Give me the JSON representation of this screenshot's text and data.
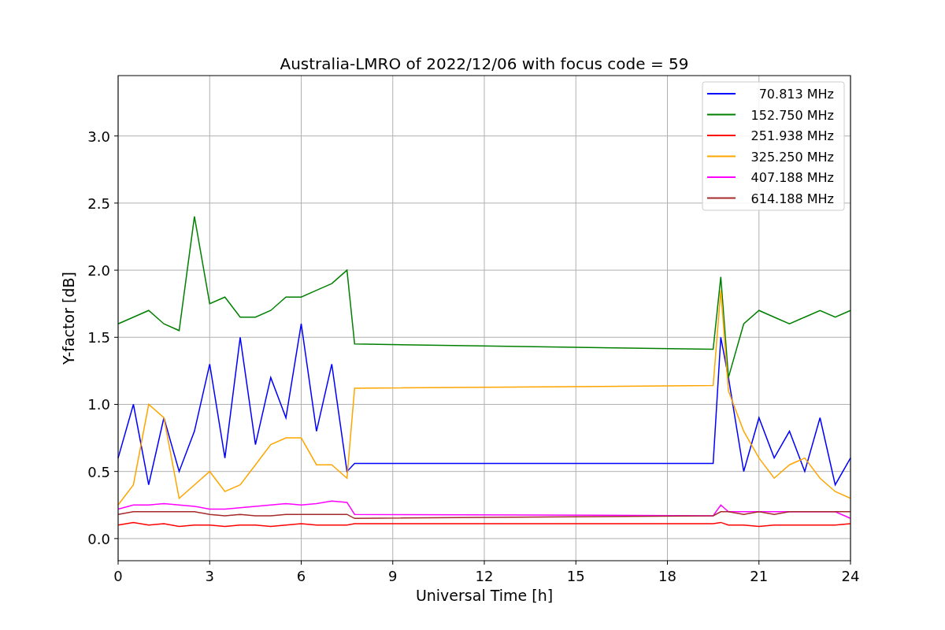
{
  "chart_data": {
    "type": "line",
    "title": "Australia-LMRO of 2022/12/06 with focus code = 59",
    "xlabel": "Universal Time [h]",
    "ylabel": "Y-factor [dB]",
    "x": [
      0,
      0.5,
      1,
      1.5,
      2,
      2.5,
      3,
      3.5,
      4,
      4.5,
      5,
      5.5,
      6,
      6.5,
      7,
      7.5,
      7.75,
      19.5,
      19.75,
      20,
      20.5,
      21,
      21.5,
      22,
      22.5,
      23,
      23.5,
      24
    ],
    "series": [
      {
        "name": "70.813 MHz",
        "color": "#0000ff",
        "values": [
          0.6,
          1.0,
          0.4,
          0.9,
          0.5,
          0.8,
          1.3,
          0.6,
          1.5,
          0.7,
          1.2,
          0.9,
          1.6,
          0.8,
          1.3,
          0.5,
          0.56,
          0.56,
          1.5,
          1.2,
          0.5,
          0.9,
          0.6,
          0.8,
          0.5,
          0.9,
          0.4,
          0.6
        ]
      },
      {
        "name": "152.750 MHz",
        "color": "#008000",
        "values": [
          1.6,
          1.65,
          1.7,
          1.6,
          1.55,
          2.4,
          1.75,
          1.8,
          1.65,
          1.65,
          1.7,
          1.8,
          1.8,
          1.85,
          1.9,
          2.0,
          1.45,
          1.41,
          1.95,
          1.2,
          1.6,
          1.7,
          1.65,
          1.6,
          1.65,
          1.7,
          1.65,
          1.7
        ]
      },
      {
        "name": "251.938 MHz",
        "color": "#ff0000",
        "values": [
          0.1,
          0.12,
          0.1,
          0.11,
          0.09,
          0.1,
          0.1,
          0.09,
          0.1,
          0.1,
          0.09,
          0.1,
          0.11,
          0.1,
          0.1,
          0.1,
          0.11,
          0.11,
          0.12,
          0.1,
          0.1,
          0.09,
          0.1,
          0.1,
          0.1,
          0.1,
          0.1,
          0.11
        ]
      },
      {
        "name": "325.250 MHz",
        "color": "#ffa500",
        "values": [
          0.25,
          0.4,
          1.0,
          0.9,
          0.3,
          0.4,
          0.5,
          0.35,
          0.4,
          0.55,
          0.7,
          0.75,
          0.75,
          0.55,
          0.55,
          0.45,
          1.12,
          1.14,
          1.85,
          1.1,
          0.8,
          0.6,
          0.45,
          0.55,
          0.6,
          0.45,
          0.35,
          0.3
        ]
      },
      {
        "name": "407.188 MHz",
        "color": "#ff00ff",
        "values": [
          0.22,
          0.25,
          0.25,
          0.26,
          0.25,
          0.24,
          0.22,
          0.22,
          0.23,
          0.24,
          0.25,
          0.26,
          0.25,
          0.26,
          0.28,
          0.27,
          0.18,
          0.17,
          0.25,
          0.2,
          0.2,
          0.2,
          0.2,
          0.2,
          0.2,
          0.2,
          0.2,
          0.15
        ]
      },
      {
        "name": "614.188 MHz",
        "color": "#a52a2a",
        "values": [
          0.18,
          0.2,
          0.2,
          0.2,
          0.2,
          0.2,
          0.18,
          0.17,
          0.18,
          0.17,
          0.17,
          0.18,
          0.18,
          0.18,
          0.18,
          0.18,
          0.15,
          0.17,
          0.2,
          0.2,
          0.18,
          0.2,
          0.18,
          0.2,
          0.2,
          0.2,
          0.2,
          0.2
        ]
      }
    ],
    "grid": true,
    "legend": true,
    "xlim": [
      0,
      24
    ],
    "ylim": [
      -0.165,
      3.45
    ],
    "xticks": [
      0,
      3,
      6,
      9,
      12,
      15,
      18,
      21,
      24
    ],
    "yticks": [
      {
        "value": 0,
        "label": "0.0"
      },
      {
        "value": 0.5,
        "label": "0.5"
      },
      {
        "value": 1,
        "label": "1.0"
      },
      {
        "value": 1.5,
        "label": "1.5"
      },
      {
        "value": 2,
        "label": "2.0"
      },
      {
        "value": 2.5,
        "label": "2.5"
      },
      {
        "value": 3,
        "label": "3.0"
      }
    ]
  }
}
